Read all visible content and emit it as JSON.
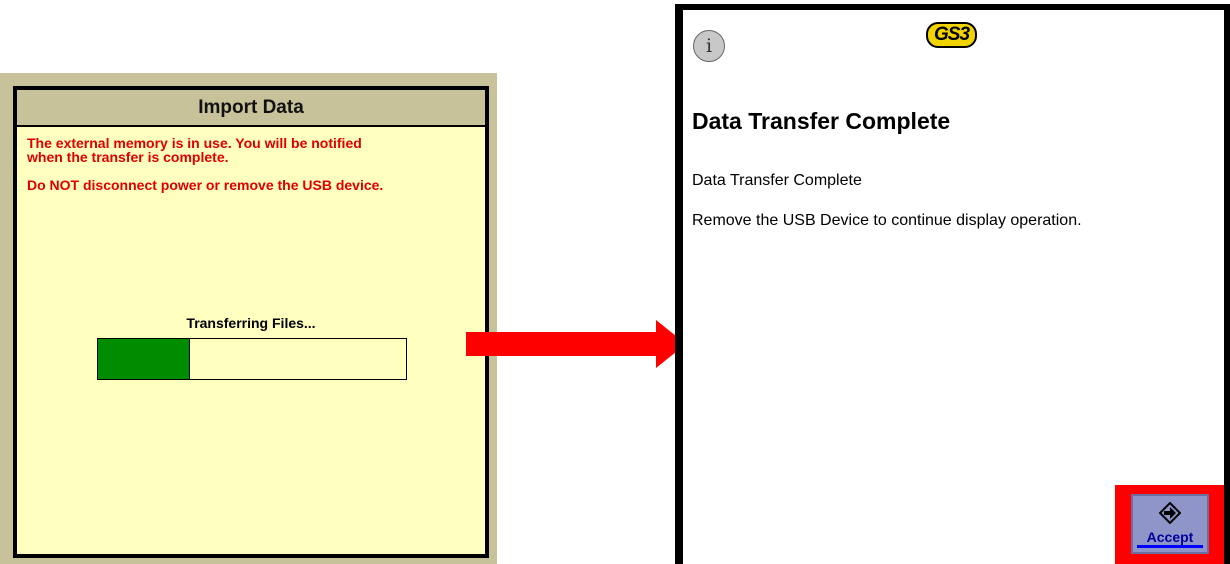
{
  "import_dialog": {
    "title": "Import Data",
    "warning_line1": "The external memory is in use.  You will be notified",
    "warning_line2": "when the transfer is complete.",
    "warning_line3": "Do NOT disconnect power or remove the USB device.",
    "progress_label": "Transferring Files...",
    "progress_fraction": 0.3
  },
  "gs3_screen": {
    "logo": "GS3",
    "info_icon": "info-icon",
    "title": "Data Transfer Complete",
    "message1": "Data Transfer Complete",
    "message2": "Remove the USB Device to continue display operation.",
    "accept_label": "Accept"
  },
  "colors": {
    "warning_text": "#e00000",
    "panel_bg": "#ffffc0",
    "header_bg": "#c8c29a",
    "progress_fill": "#008c00",
    "arrow": "#ff0000",
    "accept_bg": "#8f95c8",
    "logo_yellow": "#f1d300"
  }
}
